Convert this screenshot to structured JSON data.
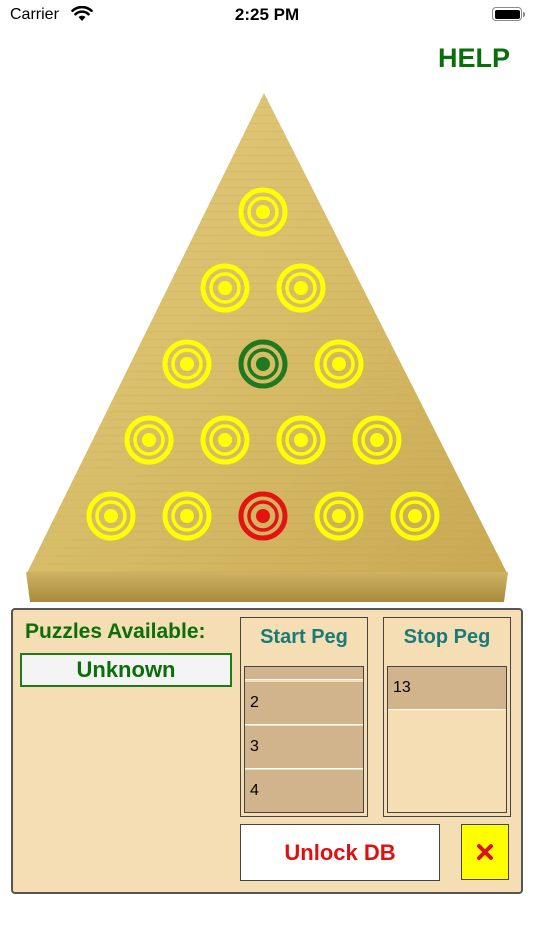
{
  "status_bar": {
    "carrier": "Carrier",
    "time": "2:25 PM"
  },
  "header": {
    "help_label": "HELP"
  },
  "board": {
    "holes": [
      {
        "id": 1,
        "state": "peg"
      },
      {
        "id": 2,
        "state": "peg"
      },
      {
        "id": 3,
        "state": "peg"
      },
      {
        "id": 4,
        "state": "peg"
      },
      {
        "id": 5,
        "state": "start"
      },
      {
        "id": 6,
        "state": "peg"
      },
      {
        "id": 7,
        "state": "peg"
      },
      {
        "id": 8,
        "state": "peg"
      },
      {
        "id": 9,
        "state": "peg"
      },
      {
        "id": 10,
        "state": "peg"
      },
      {
        "id": 11,
        "state": "peg"
      },
      {
        "id": 12,
        "state": "peg"
      },
      {
        "id": 13,
        "state": "stop"
      },
      {
        "id": 14,
        "state": "peg"
      },
      {
        "id": 15,
        "state": "peg"
      }
    ],
    "colors": {
      "peg": "#ffff00",
      "start": "#1f7a1f",
      "stop": "#e51212",
      "wood": "#d9bf6c"
    }
  },
  "panel": {
    "puzzles_label": "Puzzles Available:",
    "puzzles_value": "Unknown",
    "start_peg": {
      "title": "Start Peg",
      "options": [
        "",
        "2",
        "3",
        "4"
      ]
    },
    "stop_peg": {
      "title": "Stop Peg",
      "options": [
        "13"
      ]
    },
    "unlock_label": "Unlock DB",
    "close_icon": "x-icon"
  }
}
